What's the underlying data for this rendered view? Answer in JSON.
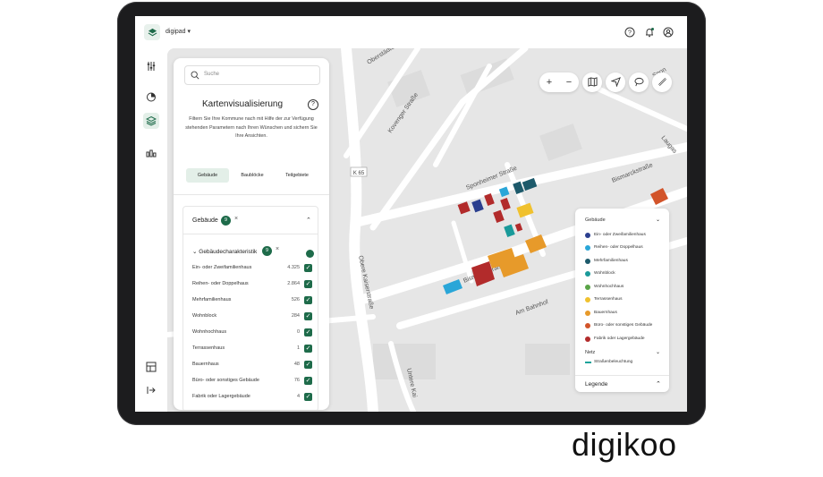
{
  "app": {
    "name": "digipad",
    "brand": "digikoo"
  },
  "search": {
    "placeholder": "Suche"
  },
  "panel": {
    "title": "Kartenvisualisierung",
    "help_glyph": "?",
    "description": "Filtern Sie Ihre Kommune nach mit Hilfe der zur Verfügung stehenden Parametern nach Ihren Wünschen und sichern Sie Ihre Ansichten.",
    "tabs": [
      {
        "label": "Gebäude",
        "active": true
      },
      {
        "label": "Baublöcke",
        "active": false
      },
      {
        "label": "Teilgebiete",
        "active": false
      }
    ],
    "section": {
      "label": "Gebäude",
      "badge": "9"
    },
    "subsection": {
      "label": "Gebäudecharakteristik",
      "badge": "9"
    },
    "rows": [
      {
        "label": "Ein- oder Zweifamilienhaus",
        "count": "4.325"
      },
      {
        "label": "Reihen- oder Doppelhaus",
        "count": "2.864"
      },
      {
        "label": "Mehrfamilienhaus",
        "count": "526"
      },
      {
        "label": "Wohnblock",
        "count": "284"
      },
      {
        "label": "Wohnhochhaus",
        "count": "0"
      },
      {
        "label": "Terrassenhaus",
        "count": "1"
      },
      {
        "label": "Bauernhaus",
        "count": "48"
      },
      {
        "label": "Büro- oder sonstiges Gebäude",
        "count": "76"
      },
      {
        "label": "Fabrik oder Lagergebäude",
        "count": "4"
      }
    ]
  },
  "map": {
    "streets": [
      "Oberstädter Straße",
      "Kovenger Straße",
      "Sponheimer Straße",
      "Bismarckstraße",
      "Obere Kaiserstraße",
      "Am Bahnhof",
      "Untere Kai",
      "K 65",
      "Laugas",
      "Spon"
    ],
    "tools": [
      "zoom-in",
      "zoom-out",
      "book-icon",
      "locate-icon",
      "lasso-icon",
      "ruler-icon"
    ]
  },
  "legend": {
    "section": "Gebäude",
    "items": [
      {
        "label": "Ein- oder Zweifamilienhaus",
        "color": "#2b3f8f"
      },
      {
        "label": "Reihen- oder Doppelhaus",
        "color": "#2aa6d8"
      },
      {
        "label": "Mehrfamilienhaus",
        "color": "#1d5a6b"
      },
      {
        "label": "Wohnblock",
        "color": "#1a9a9a"
      },
      {
        "label": "Wohnhochhaus",
        "color": "#5aa447"
      },
      {
        "label": "Terrassenhaus",
        "color": "#f0c12e"
      },
      {
        "label": "Bauernhaus",
        "color": "#e79a2a"
      },
      {
        "label": "Büro- oder sonstiges Gebäude",
        "color": "#d2542a"
      },
      {
        "label": "Fabrik oder Lagergebäude",
        "color": "#b22b2b"
      }
    ],
    "net_section": "Netz",
    "net_item": {
      "label": "Straßenbeleuchtung",
      "color": "#1aa39a"
    },
    "footer": "Legende"
  }
}
